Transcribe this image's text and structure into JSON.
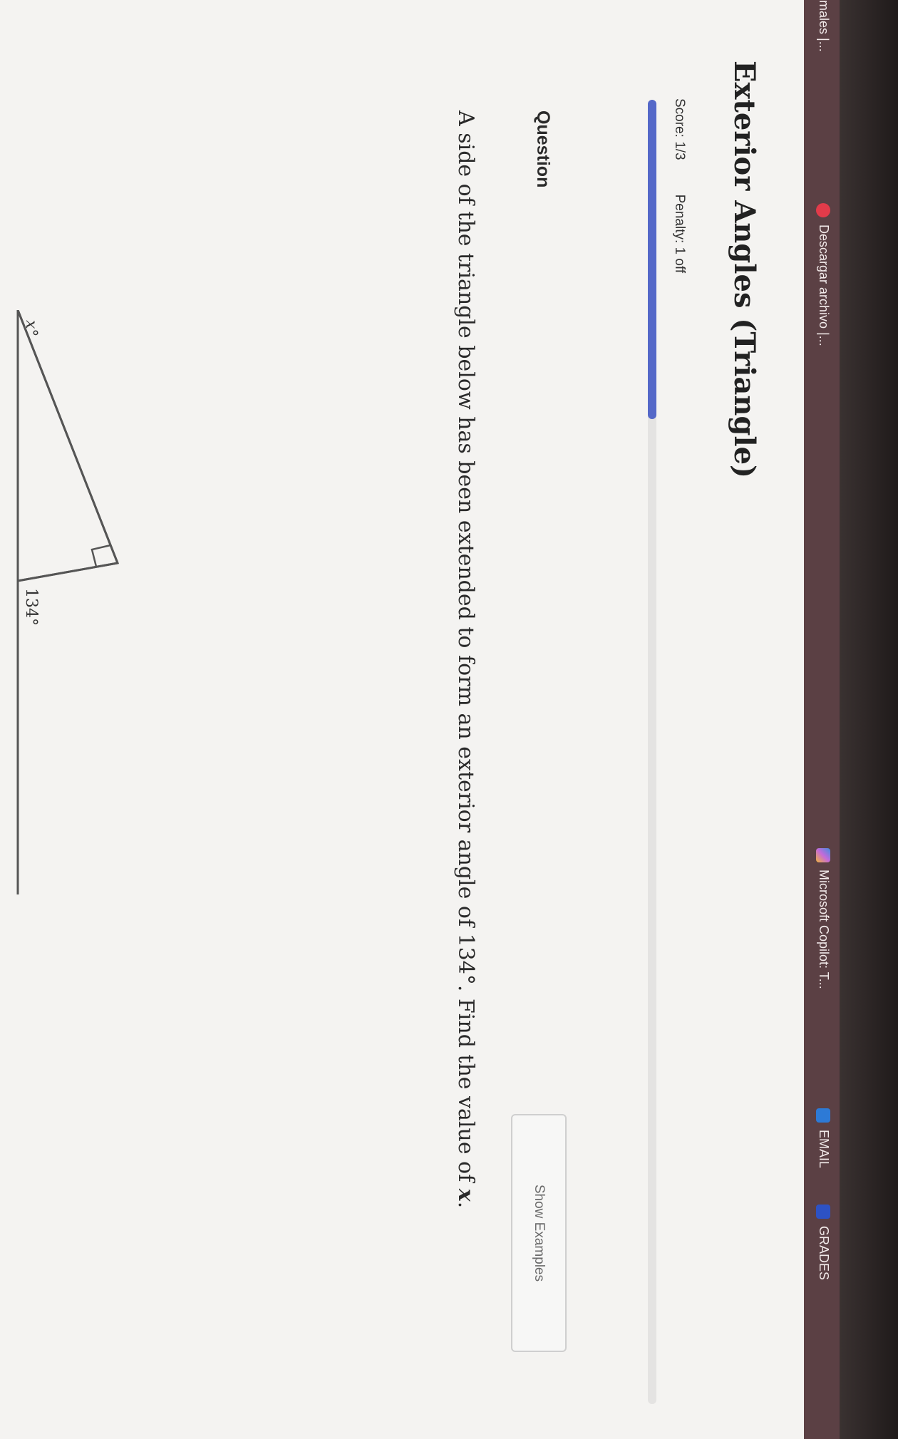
{
  "bookmarks": [
    {
      "label": "males |...",
      "icon": "page-icon",
      "color": "#9a8a8c"
    },
    {
      "label": "Descargar archivo |...",
      "icon": "download-icon",
      "color": "#e23b4a"
    },
    {
      "label": "Microsoft Copilot: T...",
      "icon": "copilot-icon",
      "color": "#3f8de0"
    },
    {
      "label": "EMAIL",
      "icon": "email-icon",
      "color": "#2d7ad6"
    },
    {
      "label": "GRADES",
      "icon": "grades-icon",
      "color": "#2d52c4"
    }
  ],
  "page": {
    "title": "Exterior Angles (Triangle)",
    "score": "Score: 1/3",
    "penalty": "Penalty: 1 off",
    "progress_fraction": 0.245,
    "accent_color": "#5468c8"
  },
  "question": {
    "heading": "Question",
    "show_examples": "Show Examples",
    "text_before": "A side of the triangle below has been extended to form an exterior angle of ",
    "angle_value": "134°",
    "text_after": ". Find the value of ",
    "variable": "x",
    "end": "."
  },
  "diagram": {
    "label_x": "x°",
    "label_exterior": "134°"
  }
}
